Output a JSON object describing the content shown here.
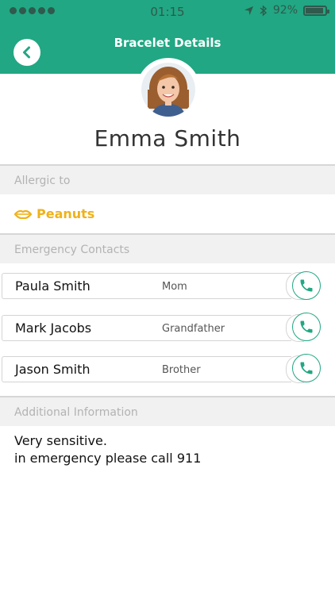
{
  "status_bar": {
    "time": "01:15",
    "battery": "92%",
    "battery_fraction": 0.92,
    "signal_dots": 5
  },
  "header": {
    "title": "Bracelet Details",
    "back_icon": "chevron-left-icon"
  },
  "profile": {
    "name": "Emma Smith"
  },
  "allergies": {
    "section_label": "Allergic to",
    "items": [
      {
        "label": "Peanuts",
        "icon": "lips-icon",
        "color": "#efb21a"
      }
    ]
  },
  "contacts": {
    "section_label": "Emergency Contacts",
    "items": [
      {
        "name": "Paula  Smith",
        "relation": "Mom"
      },
      {
        "name": "Mark Jacobs",
        "relation": "Grandfather"
      },
      {
        "name": "Jason Smith",
        "relation": "Brother"
      }
    ]
  },
  "additional": {
    "section_label": "Additional Information",
    "line1": "Very sensitive.",
    "line2": "in emergency please call 911"
  },
  "colors": {
    "accent": "#21a783",
    "allergy": "#efb21a"
  }
}
